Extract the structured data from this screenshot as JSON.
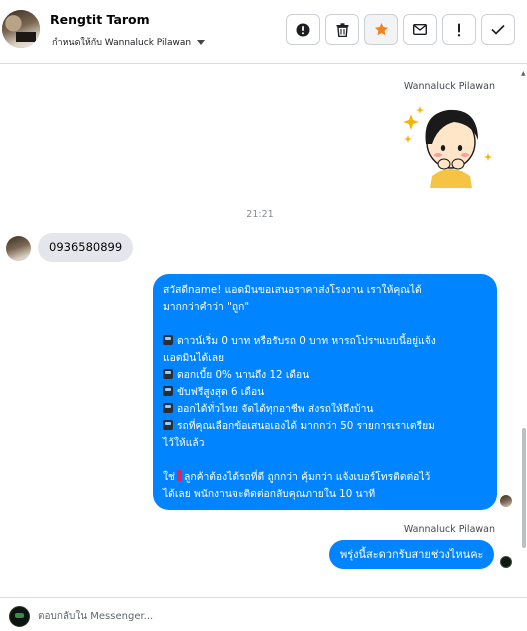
{
  "header": {
    "contact_name": "Rengtit Tarom",
    "assign_label": "กำหนดให้กับ Wannaluck Pilawan",
    "toolbar": [
      {
        "icon": "alert-circle-icon"
      },
      {
        "icon": "trash-icon"
      },
      {
        "icon": "star-icon"
      },
      {
        "icon": "mail-icon"
      },
      {
        "icon": "exclamation-icon"
      },
      {
        "icon": "check-icon"
      }
    ],
    "colors": {
      "star": "#f5821f"
    }
  },
  "conversation": {
    "sticker_sender": "Wannaluck Pilawan",
    "timestamp": "21:21",
    "incoming_message": "0936580899",
    "outgoing_long": {
      "intro_1": "สวัสดีname! แอดมินขอเสนอราคาส่งโรงงาน เราให้คุณได้",
      "intro_2": "มากกว่าคำว่า \"ถูก\"",
      "b1_1": "ดาวน์เริ่ม 0 บาท หรือรับรถ 0 บาท หารถโปรฯแบบนี้อยู่แจ้ง",
      "b1_2": "แอดมินได้เลย",
      "b2": "ดอกเบี้ย 0% นานถึง 12 เดือน",
      "b3": "ขับฟรีสูงสุด 6 เดือน",
      "b4": "ออกได้ทั่วไทย จัดได้ทุกอาชีพ ส่งรถให้ถึงบ้าน",
      "b5_1": "รถที่คุณเลือกข้อเสนอเองได้ มากกว่า 50 รายการเราเตรียม",
      "b5_2": "ไว้ให้แล้ว",
      "cta_1a": "ใช่",
      "cta_1b": "ลูกค้าต้องได้รถที่ดี ถูกกว่า คุ้มกว่า แจ้งเบอร์โทรติดต่อไว้",
      "cta_2": "ได้เลย พนักงานจะติดต่อกลับคุณภายใน 10 นาที"
    },
    "second_sender": "Wannaluck Pilawan",
    "outgoing_short": "พรุ่งนี้สะดวกรับสายช่วงไหนคะ",
    "bubble_color": "#0084ff",
    "incoming_bubble_color": "#e4e6eb"
  },
  "composer": {
    "placeholder": "ตอบกลับใน Messenger..."
  }
}
